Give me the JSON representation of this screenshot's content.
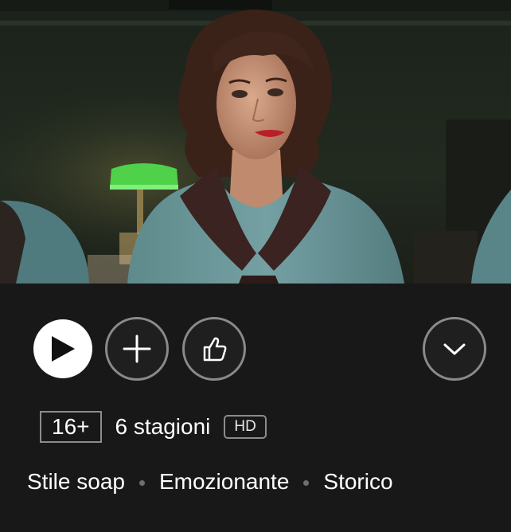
{
  "hero": {
    "image": "still of a woman with dark wavy hair in a teal uniform with a dark collar, green desk lamp in background"
  },
  "actions": {
    "play": {
      "icon": "play-icon"
    },
    "add": {
      "icon": "plus-icon"
    },
    "rate": {
      "icon": "thumbs-up-icon"
    },
    "more": {
      "icon": "chevron-down-icon"
    }
  },
  "meta": {
    "maturity_rating": "16+",
    "seasons": "6 stagioni",
    "quality_badge": "HD"
  },
  "tags": [
    "Stile soap",
    "Emozionante",
    "Storico"
  ],
  "colors": {
    "background": "#181818",
    "button_outline": "#8a8a8a",
    "dot": "#6e6e6e"
  }
}
